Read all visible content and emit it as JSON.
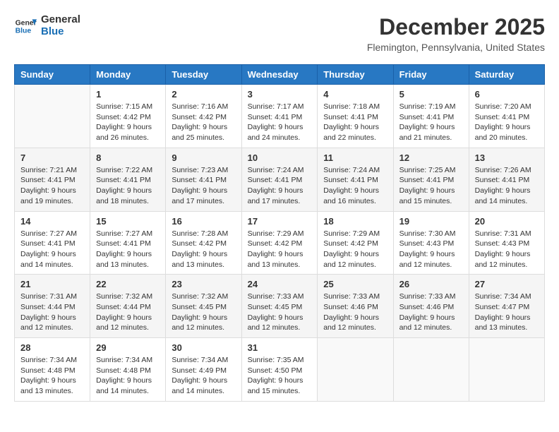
{
  "logo": {
    "line1": "General",
    "line2": "Blue"
  },
  "title": "December 2025",
  "location": "Flemington, Pennsylvania, United States",
  "days_of_week": [
    "Sunday",
    "Monday",
    "Tuesday",
    "Wednesday",
    "Thursday",
    "Friday",
    "Saturday"
  ],
  "weeks": [
    [
      {
        "day": "",
        "sunrise": "",
        "sunset": "",
        "daylight": ""
      },
      {
        "day": "1",
        "sunrise": "Sunrise: 7:15 AM",
        "sunset": "Sunset: 4:42 PM",
        "daylight": "Daylight: 9 hours and 26 minutes."
      },
      {
        "day": "2",
        "sunrise": "Sunrise: 7:16 AM",
        "sunset": "Sunset: 4:42 PM",
        "daylight": "Daylight: 9 hours and 25 minutes."
      },
      {
        "day": "3",
        "sunrise": "Sunrise: 7:17 AM",
        "sunset": "Sunset: 4:41 PM",
        "daylight": "Daylight: 9 hours and 24 minutes."
      },
      {
        "day": "4",
        "sunrise": "Sunrise: 7:18 AM",
        "sunset": "Sunset: 4:41 PM",
        "daylight": "Daylight: 9 hours and 22 minutes."
      },
      {
        "day": "5",
        "sunrise": "Sunrise: 7:19 AM",
        "sunset": "Sunset: 4:41 PM",
        "daylight": "Daylight: 9 hours and 21 minutes."
      },
      {
        "day": "6",
        "sunrise": "Sunrise: 7:20 AM",
        "sunset": "Sunset: 4:41 PM",
        "daylight": "Daylight: 9 hours and 20 minutes."
      }
    ],
    [
      {
        "day": "7",
        "sunrise": "Sunrise: 7:21 AM",
        "sunset": "Sunset: 4:41 PM",
        "daylight": "Daylight: 9 hours and 19 minutes."
      },
      {
        "day": "8",
        "sunrise": "Sunrise: 7:22 AM",
        "sunset": "Sunset: 4:41 PM",
        "daylight": "Daylight: 9 hours and 18 minutes."
      },
      {
        "day": "9",
        "sunrise": "Sunrise: 7:23 AM",
        "sunset": "Sunset: 4:41 PM",
        "daylight": "Daylight: 9 hours and 17 minutes."
      },
      {
        "day": "10",
        "sunrise": "Sunrise: 7:24 AM",
        "sunset": "Sunset: 4:41 PM",
        "daylight": "Daylight: 9 hours and 17 minutes."
      },
      {
        "day": "11",
        "sunrise": "Sunrise: 7:24 AM",
        "sunset": "Sunset: 4:41 PM",
        "daylight": "Daylight: 9 hours and 16 minutes."
      },
      {
        "day": "12",
        "sunrise": "Sunrise: 7:25 AM",
        "sunset": "Sunset: 4:41 PM",
        "daylight": "Daylight: 9 hours and 15 minutes."
      },
      {
        "day": "13",
        "sunrise": "Sunrise: 7:26 AM",
        "sunset": "Sunset: 4:41 PM",
        "daylight": "Daylight: 9 hours and 14 minutes."
      }
    ],
    [
      {
        "day": "14",
        "sunrise": "Sunrise: 7:27 AM",
        "sunset": "Sunset: 4:41 PM",
        "daylight": "Daylight: 9 hours and 14 minutes."
      },
      {
        "day": "15",
        "sunrise": "Sunrise: 7:27 AM",
        "sunset": "Sunset: 4:41 PM",
        "daylight": "Daylight: 9 hours and 13 minutes."
      },
      {
        "day": "16",
        "sunrise": "Sunrise: 7:28 AM",
        "sunset": "Sunset: 4:42 PM",
        "daylight": "Daylight: 9 hours and 13 minutes."
      },
      {
        "day": "17",
        "sunrise": "Sunrise: 7:29 AM",
        "sunset": "Sunset: 4:42 PM",
        "daylight": "Daylight: 9 hours and 13 minutes."
      },
      {
        "day": "18",
        "sunrise": "Sunrise: 7:29 AM",
        "sunset": "Sunset: 4:42 PM",
        "daylight": "Daylight: 9 hours and 12 minutes."
      },
      {
        "day": "19",
        "sunrise": "Sunrise: 7:30 AM",
        "sunset": "Sunset: 4:43 PM",
        "daylight": "Daylight: 9 hours and 12 minutes."
      },
      {
        "day": "20",
        "sunrise": "Sunrise: 7:31 AM",
        "sunset": "Sunset: 4:43 PM",
        "daylight": "Daylight: 9 hours and 12 minutes."
      }
    ],
    [
      {
        "day": "21",
        "sunrise": "Sunrise: 7:31 AM",
        "sunset": "Sunset: 4:44 PM",
        "daylight": "Daylight: 9 hours and 12 minutes."
      },
      {
        "day": "22",
        "sunrise": "Sunrise: 7:32 AM",
        "sunset": "Sunset: 4:44 PM",
        "daylight": "Daylight: 9 hours and 12 minutes."
      },
      {
        "day": "23",
        "sunrise": "Sunrise: 7:32 AM",
        "sunset": "Sunset: 4:45 PM",
        "daylight": "Daylight: 9 hours and 12 minutes."
      },
      {
        "day": "24",
        "sunrise": "Sunrise: 7:33 AM",
        "sunset": "Sunset: 4:45 PM",
        "daylight": "Daylight: 9 hours and 12 minutes."
      },
      {
        "day": "25",
        "sunrise": "Sunrise: 7:33 AM",
        "sunset": "Sunset: 4:46 PM",
        "daylight": "Daylight: 9 hours and 12 minutes."
      },
      {
        "day": "26",
        "sunrise": "Sunrise: 7:33 AM",
        "sunset": "Sunset: 4:46 PM",
        "daylight": "Daylight: 9 hours and 12 minutes."
      },
      {
        "day": "27",
        "sunrise": "Sunrise: 7:34 AM",
        "sunset": "Sunset: 4:47 PM",
        "daylight": "Daylight: 9 hours and 13 minutes."
      }
    ],
    [
      {
        "day": "28",
        "sunrise": "Sunrise: 7:34 AM",
        "sunset": "Sunset: 4:48 PM",
        "daylight": "Daylight: 9 hours and 13 minutes."
      },
      {
        "day": "29",
        "sunrise": "Sunrise: 7:34 AM",
        "sunset": "Sunset: 4:48 PM",
        "daylight": "Daylight: 9 hours and 14 minutes."
      },
      {
        "day": "30",
        "sunrise": "Sunrise: 7:34 AM",
        "sunset": "Sunset: 4:49 PM",
        "daylight": "Daylight: 9 hours and 14 minutes."
      },
      {
        "day": "31",
        "sunrise": "Sunrise: 7:35 AM",
        "sunset": "Sunset: 4:50 PM",
        "daylight": "Daylight: 9 hours and 15 minutes."
      },
      {
        "day": "",
        "sunrise": "",
        "sunset": "",
        "daylight": ""
      },
      {
        "day": "",
        "sunrise": "",
        "sunset": "",
        "daylight": ""
      },
      {
        "day": "",
        "sunrise": "",
        "sunset": "",
        "daylight": ""
      }
    ]
  ]
}
